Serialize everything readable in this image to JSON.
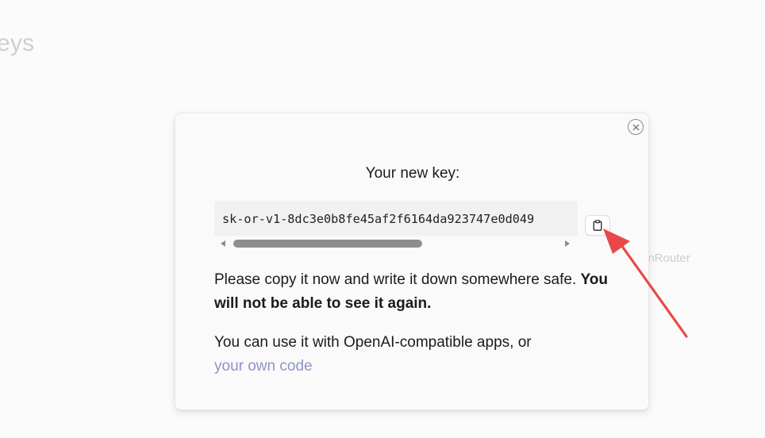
{
  "background": {
    "title_fragment": "eys",
    "brand_fragment": "enRouter"
  },
  "modal": {
    "heading": "Your new key:",
    "key_value": "sk-or-v1-8dc3e0b8fe45af2f6164da923747e0d049",
    "warning_plain": "Please copy it now and write it down somewhere safe.",
    "warning_bold": "You will not be able to see it again.",
    "usage_text": "You can use it with OpenAI-compatible apps, or",
    "usage_link": "your own code",
    "close_icon": "close-circle-icon",
    "copy_icon": "clipboard-icon"
  },
  "annotation": {
    "arrow_color": "#e8484a"
  },
  "colors": {
    "link": "#8f93c9",
    "text": "#1b1b1b"
  }
}
